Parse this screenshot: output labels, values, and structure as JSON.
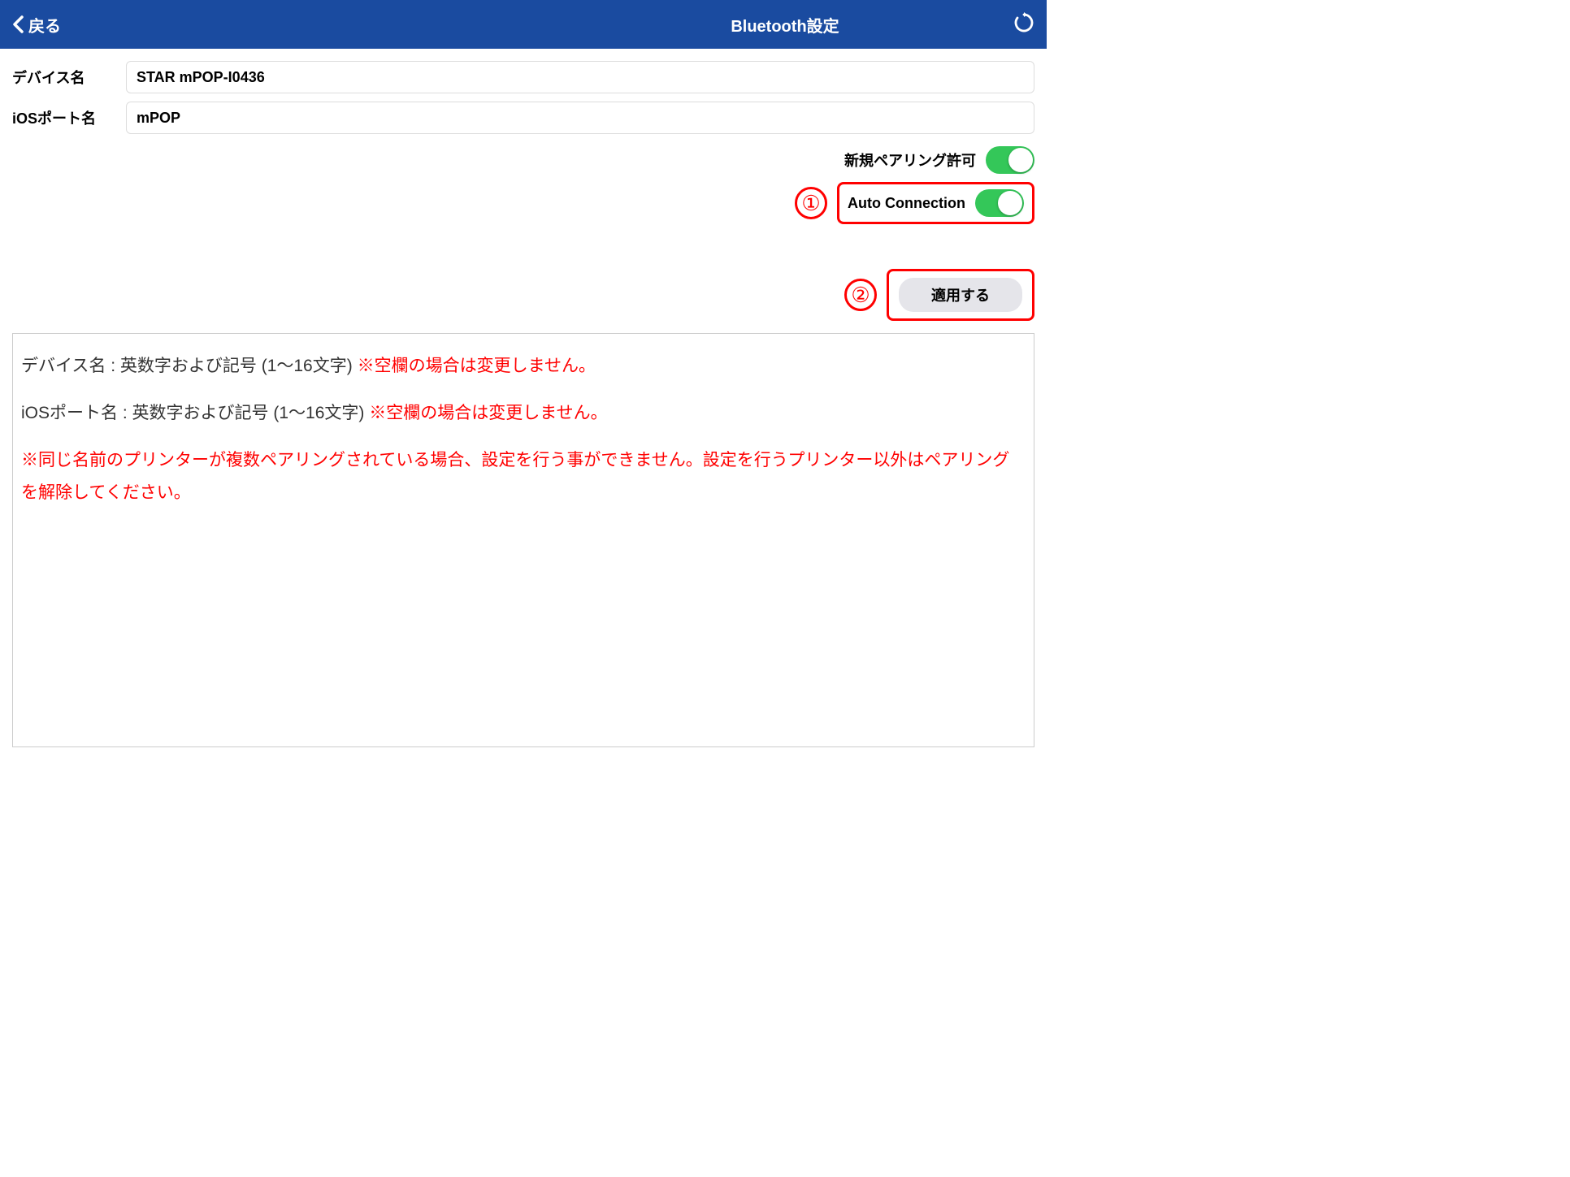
{
  "header": {
    "back_label": "戻る",
    "title": "Bluetooth設定"
  },
  "form": {
    "device_name_label": "デバイス名",
    "device_name_value": "STAR mPOP-I0436",
    "ios_port_label": "iOSポート名",
    "ios_port_value": "mPOP"
  },
  "toggles": {
    "pairing_label": "新規ペアリング許可",
    "auto_connection_label": "Auto Connection"
  },
  "annotations": {
    "num1": "①",
    "num2": "②"
  },
  "apply_button": "適用する",
  "info": {
    "line1_prefix": "デバイス名 : 英数字および記号 (1〜16文字)  ",
    "line1_red": "※空欄の場合は変更しません。",
    "line2_prefix": "iOSポート名 : 英数字および記号 (1〜16文字)  ",
    "line2_red": "※空欄の場合は変更しません。",
    "warning": "※同じ名前のプリンターが複数ペアリングされている場合、設定を行う事ができません。設定を行うプリンター以外はペアリングを解除してください。"
  }
}
